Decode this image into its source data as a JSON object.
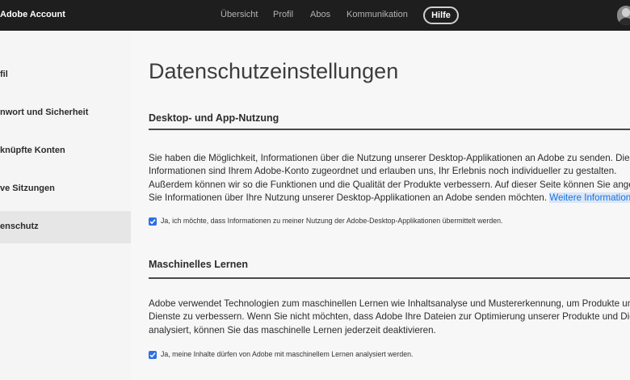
{
  "header": {
    "brand": "Adobe Account",
    "nav": [
      "Übersicht",
      "Profil",
      "Abos",
      "Kommunikation"
    ],
    "help_label": "Hilfe"
  },
  "sidebar": {
    "items": [
      {
        "label": "fil"
      },
      {
        "label": "nwort und Sicherheit"
      },
      {
        "label": "knüpfte Konten"
      },
      {
        "label": "ve Sitzungen"
      },
      {
        "label": "enschutz",
        "active": true
      }
    ]
  },
  "main": {
    "title": "Datenschutzeinstellungen",
    "sections": [
      {
        "heading": "Desktop- und App-Nutzung",
        "lines": [
          "Sie haben die Möglichkeit, Informationen über die Nutzung unserer Desktop-Applikationen an Adobe zu senden. Diese",
          "Informationen sind Ihrem Adobe-Konto zugeordnet und erlauben uns, Ihr Erlebnis noch individueller zu gestalten.",
          "Außerdem können wir so die Funktionen und die Qualität der Produkte verbessern. Auf dieser Seite können Sie angeben,",
          "Sie Informationen über Ihre Nutzung unserer Desktop-Applikationen an Adobe senden möchten."
        ],
        "link_text": "Weitere Informationen",
        "checkbox_label": "Ja, ich möchte, dass Informationen zu meiner Nutzung der Adobe-Desktop-Applikationen übermittelt werden.",
        "checked": true
      },
      {
        "heading": "Maschinelles Lernen",
        "lines": [
          "Adobe verwendet Technologien zum maschinellen Lernen wie Inhaltsanalyse und Mustererkennung, um Produkte und",
          "Dienste zu verbessern. Wenn Sie nicht möchten, dass Adobe Ihre Dateien zur Optimierung unserer Produkte und Dienste",
          "analysiert, können Sie das maschinelle Lernen jederzeit deaktivieren."
        ],
        "checkbox_label": "Ja, meine Inhalte dürfen von Adobe mit maschinellem Lernen analysiert werden.",
        "checked": true
      }
    ]
  },
  "colors": {
    "topbar": "#1e1e1e",
    "checkbox": "#2d6ee4",
    "link": "#1473e6"
  },
  "icons": [
    "avatar-icon",
    "checkmark-icon"
  ]
}
